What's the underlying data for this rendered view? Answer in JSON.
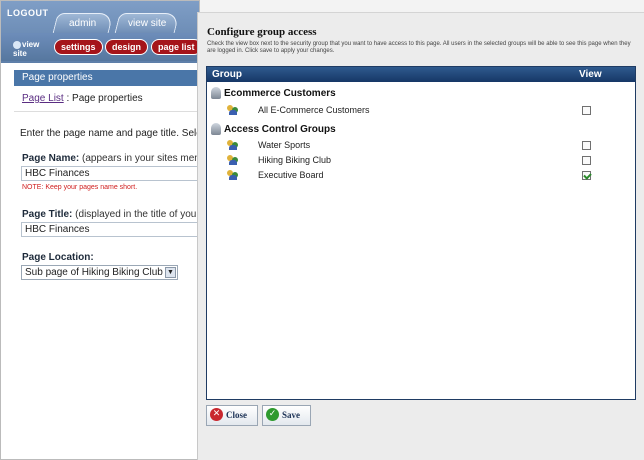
{
  "admin": {
    "logout_label": "LOGOUT",
    "tabs": [
      {
        "label": "admin"
      },
      {
        "label": "view site"
      }
    ],
    "view_site_label": "view site",
    "toolbar_buttons": [
      {
        "label": "settings"
      },
      {
        "label": "design"
      },
      {
        "label": "page list"
      }
    ],
    "panel_title": "Page properties",
    "breadcrumb": {
      "link": "Page List",
      "separator": " : ",
      "current": "Page properties"
    },
    "intro_text": "Enter the page name and page title. Sele",
    "page_name": {
      "label": "Page Name:",
      "hint": "(appears in your sites men",
      "value": "HBC Finances",
      "note": "NOTE: Keep your pages name short."
    },
    "page_title": {
      "label": "Page Title:",
      "hint": "(displayed in the title of your",
      "value": "HBC Finances"
    },
    "page_location": {
      "label": "Page Location:",
      "selected": "Sub page of Hiking Biking Club"
    }
  },
  "dialog": {
    "title": "Configure group access",
    "description": "Check the view box next to the security group that you want to have access to this page. All users in the selected groups will be able to see this page when they are logged in. Click save to apply your changes.",
    "columns": {
      "group": "Group",
      "view": "View"
    },
    "categories": [
      {
        "name": "Ecommerce Customers",
        "groups": [
          {
            "name": "All E-Commerce Customers",
            "checked": false
          }
        ]
      },
      {
        "name": "Access Control Groups",
        "groups": [
          {
            "name": "Water Sports",
            "checked": false
          },
          {
            "name": "Hiking Biking Club",
            "checked": false
          },
          {
            "name": "Executive Board",
            "checked": true
          }
        ]
      }
    ],
    "buttons": {
      "close": "Close",
      "save": "Save"
    }
  },
  "colors": {
    "header_blue": "#2f5a8e",
    "nav_red": "#a5141a",
    "close_red": "#c9282f",
    "save_green": "#2e9a2e"
  }
}
